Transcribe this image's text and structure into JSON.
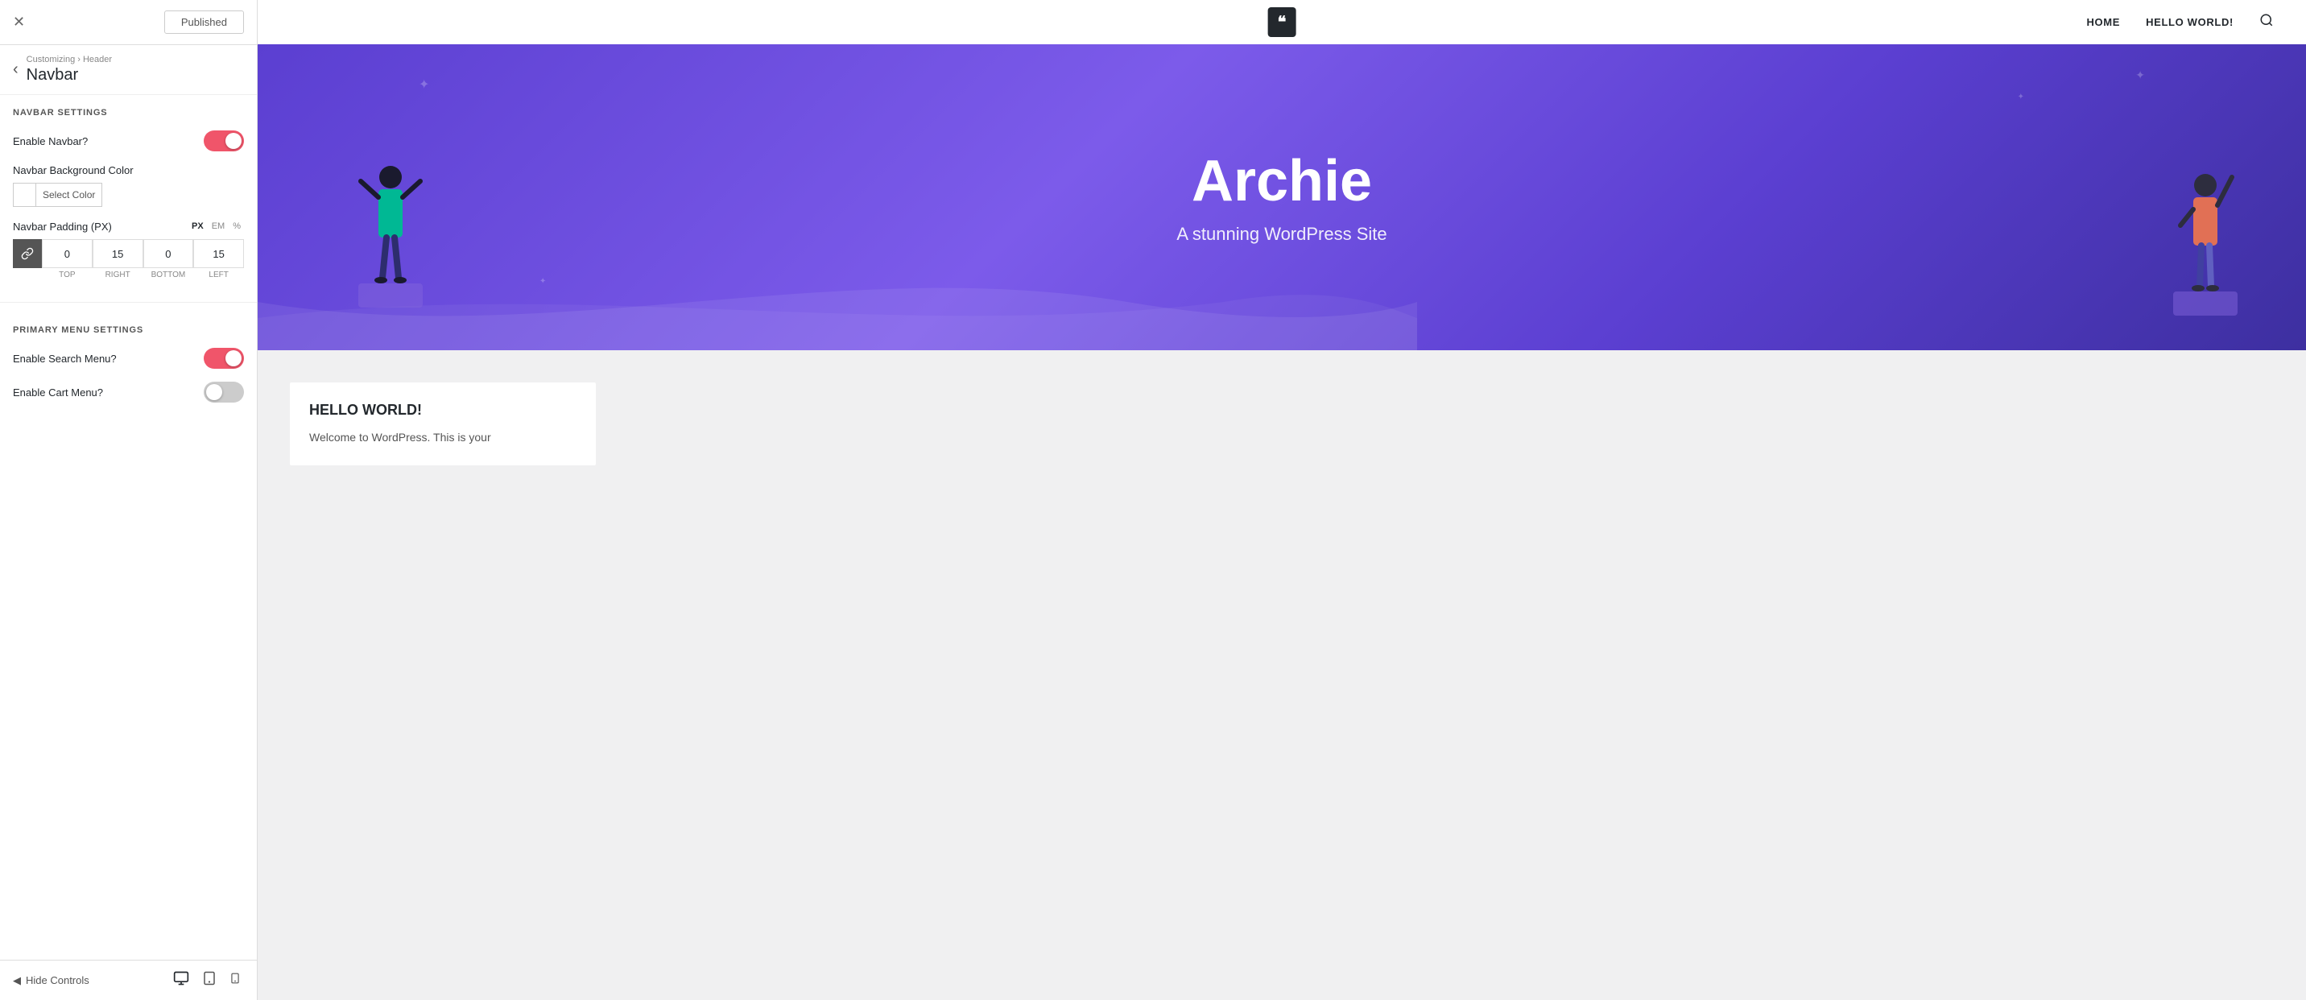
{
  "topbar": {
    "close_label": "✕",
    "published_label": "Published"
  },
  "panel_header": {
    "back_icon": "‹",
    "breadcrumb": "Customizing › Header",
    "title": "Navbar"
  },
  "navbar_section": {
    "title": "NAVBAR SETTINGS",
    "enable_navbar": {
      "label": "Enable Navbar?",
      "enabled": true
    },
    "background_color": {
      "label": "Navbar Background Color",
      "btn_label": "Select Color"
    },
    "padding": {
      "label": "Navbar Padding (PX)",
      "units": [
        "PX",
        "EM",
        "%"
      ],
      "active_unit": "PX",
      "link_icon": "⛓",
      "top": "0",
      "right": "15",
      "bottom": "0",
      "left": "15",
      "top_label": "TOP",
      "right_label": "RIGHT",
      "bottom_label": "BOTTOM",
      "left_label": "LEFT"
    }
  },
  "menu_section": {
    "title": "PRIMARY MENU SETTINGS",
    "enable_search": {
      "label": "Enable Search Menu?",
      "enabled": true
    },
    "enable_cart": {
      "label": "Enable Cart Menu?",
      "enabled": false
    }
  },
  "bottom_bar": {
    "hide_controls": "Hide Controls",
    "hide_icon": "‹",
    "device_desktop": "🖥",
    "device_tablet": "⬜",
    "device_mobile": "📱"
  },
  "site_header": {
    "logo_text": "❝",
    "nav_items": [
      "HOME",
      "HELLO WORLD!"
    ],
    "search_icon": "🔍"
  },
  "hero": {
    "title": "Archie",
    "subtitle": "A stunning WordPress Site"
  },
  "blog_card": {
    "title": "HELLO WORLD!",
    "text": "Welcome to WordPress. This is your"
  }
}
